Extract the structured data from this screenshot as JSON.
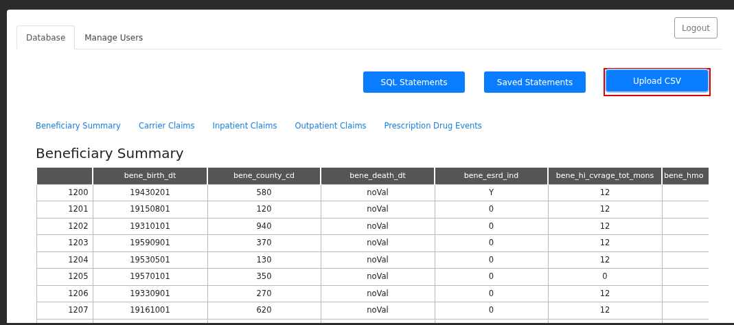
{
  "tabs": [
    {
      "label": "Database",
      "selected": true
    },
    {
      "label": "Manage Users",
      "selected": false
    }
  ],
  "logout": "Logout",
  "actions": [
    {
      "label": "SQL Statements",
      "highlighted": false
    },
    {
      "label": "Saved Statements",
      "highlighted": false
    },
    {
      "label": "Upload CSV",
      "highlighted": true
    }
  ],
  "table_links": [
    "Beneficiary Summary",
    "Carrier Claims",
    "Inpatient Claims",
    "Outpatient Claims",
    "Prescription Drug Events"
  ],
  "heading": "Beneficiary Summary",
  "table": {
    "columns": [
      "",
      "bene_birth_dt",
      "bene_county_cd",
      "bene_death_dt",
      "bene_esrd_ind",
      "bene_hi_cvrage_tot_mons",
      "bene_hmo"
    ],
    "rows": [
      [
        "1200",
        "19430201",
        "580",
        "noVal",
        "Y",
        "12",
        ""
      ],
      [
        "1201",
        "19150801",
        "120",
        "noVal",
        "0",
        "12",
        ""
      ],
      [
        "1202",
        "19310101",
        "940",
        "noVal",
        "0",
        "12",
        ""
      ],
      [
        "1203",
        "19590901",
        "370",
        "noVal",
        "0",
        "12",
        ""
      ],
      [
        "1204",
        "19530501",
        "130",
        "noVal",
        "0",
        "12",
        ""
      ],
      [
        "1205",
        "19570101",
        "350",
        "noVal",
        "0",
        "0",
        ""
      ],
      [
        "1206",
        "19330901",
        "270",
        "noVal",
        "0",
        "12",
        ""
      ],
      [
        "1207",
        "19161001",
        "620",
        "noVal",
        "0",
        "12",
        ""
      ]
    ]
  }
}
